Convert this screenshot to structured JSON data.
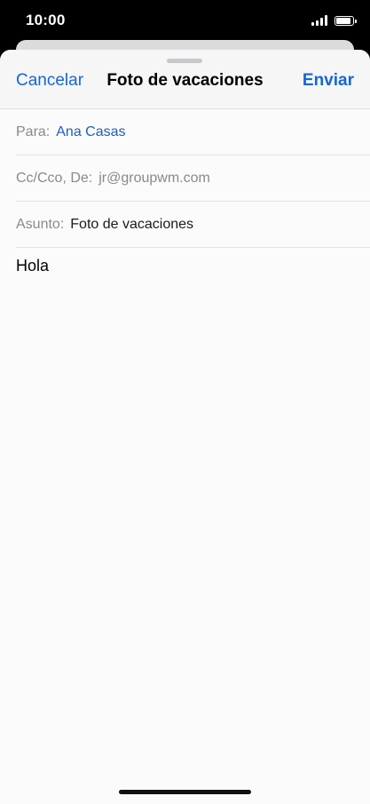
{
  "status_bar": {
    "time": "10:00",
    "signal_icon": "cellular-signal-icon",
    "battery_icon": "battery-icon",
    "battery_level": 0.9
  },
  "nav": {
    "cancel_label": "Cancelar",
    "title": "Foto de vacaciones",
    "send_label": "Enviar",
    "accent_color": "#1566d6"
  },
  "fields": {
    "to_label": "Para:",
    "to_value": "Ana Casas",
    "cc_label": "Cc/Cco, De:",
    "cc_value": "jr@groupwm.com",
    "subject_label": "Asunto:",
    "subject_value": "Foto de vacaciones"
  },
  "message": {
    "body": "Hola"
  }
}
